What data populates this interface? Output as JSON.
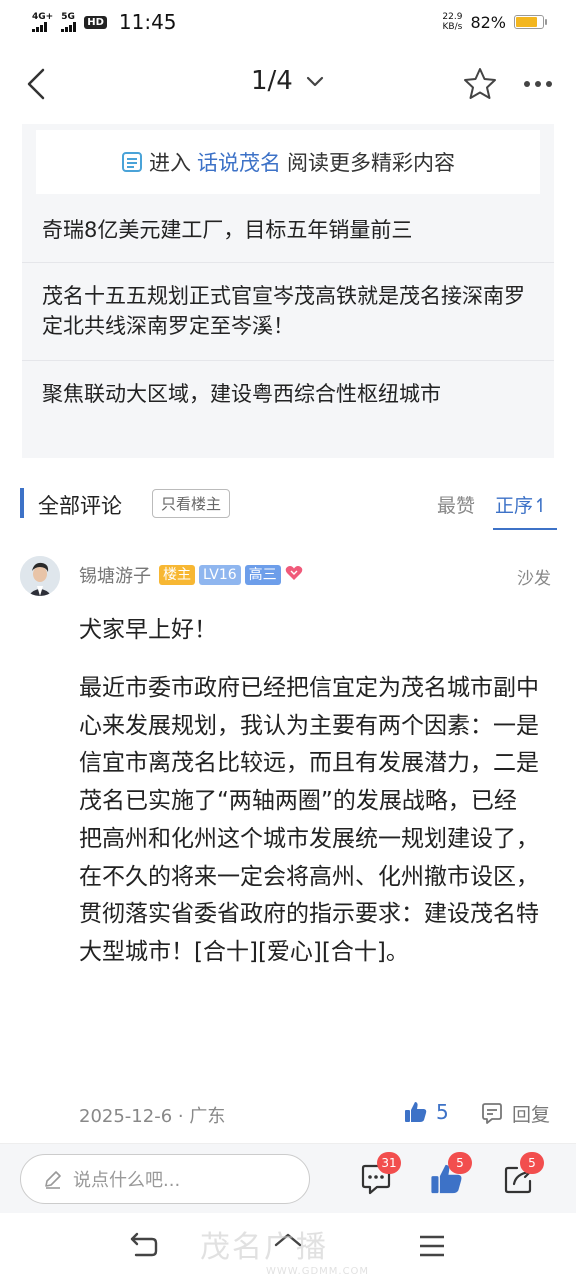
{
  "status": {
    "network1": "4G+",
    "network2": "5G",
    "hd": "HD",
    "time": "11:45",
    "speed_value": "22.9",
    "speed_unit": "KB/s",
    "battery": "82%",
    "battery_level": 0.82
  },
  "nav": {
    "page_indicator": "1/4"
  },
  "related": {
    "enter_prefix": "进入",
    "enter_link": "话说茂名",
    "enter_suffix": "阅读更多精彩内容",
    "items": [
      "奇瑞8亿美元建工厂，目标五年销量前三",
      "茂名十五五规划正式官宣岑茂高铁就是茂名接深南罗定北共线深南罗定至岑溪！",
      "聚焦联动大区域，建设粤西综合性枢纽城市"
    ]
  },
  "comments_header": {
    "title": "全部评论",
    "only_host": "只看楼主",
    "sort_hot": "最赞",
    "sort_order": "正序↿"
  },
  "comment": {
    "username": "锡塘游子",
    "badge_host": "楼主",
    "badge_level": "LV16",
    "badge_grade": "高三",
    "floor": "沙发",
    "greeting": "犬家早上好！",
    "body": "最近市委市政府已经把信宜定为茂名城市副中心来发展规划，我认为主要有两个因素：一是信宜市离茂名比较远，而且有发展潜力，二是茂名已实施了“两轴两圈”的发展战略，已经把高州和化州这个城市发展统一规划建设了，在不久的将来一定会将高州、化州撤市设区，贯彻落实省委省政府的指示要求：建设茂名特大型城市！[合十][爱心][合十]。",
    "meta": "2025-12-6 · 广东",
    "likes": "5",
    "reply_label": "回复"
  },
  "toolbar": {
    "input_placeholder": "说点什么吧...",
    "comment_count": "31",
    "like_count": "5",
    "share_count": "5"
  },
  "watermark": {
    "brand": "茂名广播",
    "url": "WWW.GDMM.COM"
  },
  "colors": {
    "accent": "#3d72c7",
    "host_badge": "#f7b733",
    "badge_red": "#f24e4e"
  }
}
